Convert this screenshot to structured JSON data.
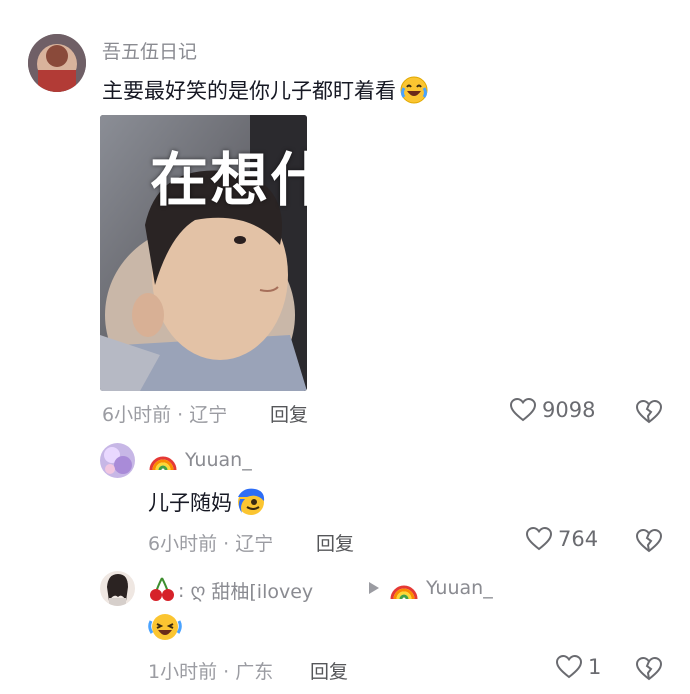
{
  "comment": {
    "username": "吾五伍日记",
    "text": "主要最好笑的是你儿子都盯着看",
    "meme_caption": "在想什",
    "time_location": "6小时前 · 辽宁",
    "reply_label": "回复",
    "likes": "9098"
  },
  "reply1": {
    "username": "Yuuan_",
    "text": "儿子随妈",
    "time_location": "6小时前 · 辽宁",
    "reply_label": "回复",
    "likes": "764"
  },
  "reply2": {
    "username": "甜柚[ilovey",
    "username_prefix": ": ღ",
    "reply_to": "Yuuan_",
    "time_location": "1小时前 · 广东",
    "reply_label": "回复",
    "likes": "1"
  },
  "icons": [
    "heart-icon",
    "broken-heart-icon",
    "rainbow-icon",
    "cherry-icon",
    "laugh-cry-emoji",
    "triangle-arrow-icon"
  ],
  "colors": {
    "text": "#161823",
    "muted": "#8a8b91",
    "meta": "#9b9ca2"
  }
}
